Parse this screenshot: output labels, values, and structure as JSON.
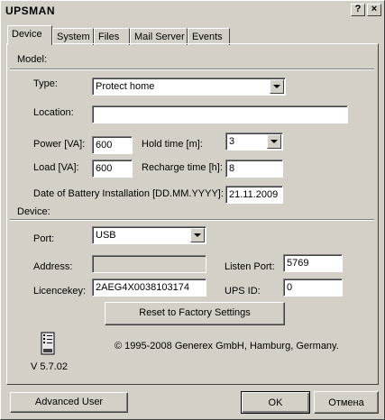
{
  "window": {
    "title": "UPSMAN",
    "help_label": "?",
    "close_label": "×"
  },
  "tabs": [
    {
      "label": "Device"
    },
    {
      "label": "System"
    },
    {
      "label": "Files"
    },
    {
      "label": "Mail Server"
    },
    {
      "label": "Events"
    }
  ],
  "model": {
    "section_label": "Model:",
    "type_label": "Type:",
    "type_value": "Protect home",
    "location_label": "Location:",
    "location_value": "",
    "power_label": "Power [VA]:",
    "power_value": "600",
    "hold_label": "Hold time [m]:",
    "hold_value": "3",
    "load_label": "Load [VA]:",
    "load_value": "600",
    "recharge_label": "Recharge time [h]:",
    "recharge_value": "8",
    "battery_label": "Date of Battery Installation [DD.MM.YYYY]:",
    "battery_value": "21.11.2009"
  },
  "device": {
    "section_label": "Device:",
    "port_label": "Port:",
    "port_value": "USB",
    "address_label": "Address:",
    "address_value": "",
    "listen_label": "Listen Port:",
    "listen_value": "5769",
    "licence_label": "Licencekey:",
    "licence_value": "2AEG4X0038103174",
    "upsid_label": "UPS ID:",
    "upsid_value": "0",
    "reset_label": "Reset to Factory Settings"
  },
  "footer": {
    "copyright": "© 1995-2008 Generex GmbH, Hamburg, Germany.",
    "version": "V  5.7.02"
  },
  "buttons": {
    "advanced_user": "Advanced User",
    "ok": "OK",
    "cancel": "Отмена"
  }
}
